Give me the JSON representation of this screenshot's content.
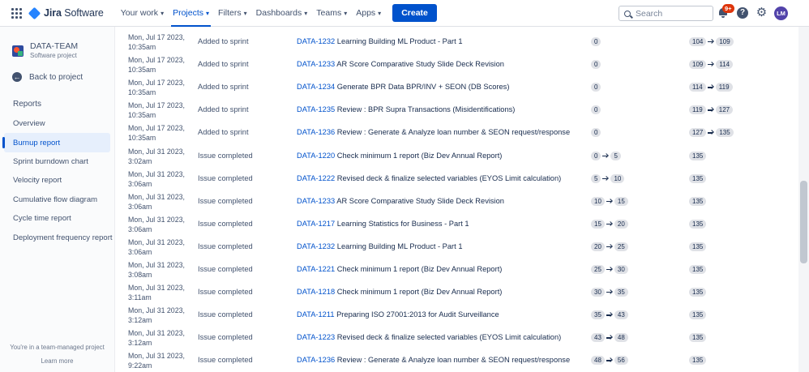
{
  "topnav": {
    "logo_bold": "Jira",
    "logo_rest": " Software",
    "items": [
      {
        "label": "Your work"
      },
      {
        "label": "Projects"
      },
      {
        "label": "Filters"
      },
      {
        "label": "Dashboards"
      },
      {
        "label": "Teams"
      },
      {
        "label": "Apps"
      }
    ],
    "active_item": "Projects",
    "create_label": "Create",
    "search_placeholder": "Search",
    "notifications_badge": "9+",
    "help_glyph": "?",
    "avatar_initials": "LM",
    "colors": {
      "primary": "#0052cc",
      "badge": "#de350b",
      "avatar": "#5243aa"
    }
  },
  "sidebar": {
    "project_name": "DATA-TEAM",
    "project_type": "Software project",
    "back_label": "Back to project",
    "section_heading": "Reports",
    "items": [
      {
        "label": "Overview",
        "active": false
      },
      {
        "label": "Burnup report",
        "active": true
      },
      {
        "label": "Sprint burndown chart",
        "active": false
      },
      {
        "label": "Velocity report",
        "active": false
      },
      {
        "label": "Cumulative flow diagram",
        "active": false
      },
      {
        "label": "Cycle time report",
        "active": false
      },
      {
        "label": "Deployment frequency report",
        "active": false
      }
    ],
    "footer_text": "You're in a team-managed project",
    "footer_link": "Learn more"
  },
  "rows": [
    {
      "date1": "Mon, Jul 17 2023,",
      "date2": "10:35am",
      "event": "Added to sprint",
      "key": "DATA-1232",
      "summary": "Learning Building ML Product - Part 1",
      "points": [
        "0"
      ],
      "total": [
        "104",
        "109"
      ]
    },
    {
      "date1": "Mon, Jul 17 2023,",
      "date2": "10:35am",
      "event": "Added to sprint",
      "key": "DATA-1233",
      "summary": "AR Score Comparative Study Slide Deck Revision",
      "points": [
        "0"
      ],
      "total": [
        "109",
        "114"
      ]
    },
    {
      "date1": "Mon, Jul 17 2023,",
      "date2": "10:35am",
      "event": "Added to sprint",
      "key": "DATA-1234",
      "summary": "Generate BPR Data BPR/INV + SEON (DB Scores)",
      "points": [
        "0"
      ],
      "total": [
        "114",
        "119"
      ]
    },
    {
      "date1": "Mon, Jul 17 2023,",
      "date2": "10:35am",
      "event": "Added to sprint",
      "key": "DATA-1235",
      "summary": "Review : BPR Supra Transactions (Misidentifications)",
      "points": [
        "0"
      ],
      "total": [
        "119",
        "127"
      ]
    },
    {
      "date1": "Mon, Jul 17 2023,",
      "date2": "10:35am",
      "event": "Added to sprint",
      "key": "DATA-1236",
      "summary": "Review : Generate & Analyze loan number & SEON request/response",
      "points": [
        "0"
      ],
      "total": [
        "127",
        "135"
      ]
    },
    {
      "date1": "Mon, Jul 31 2023,",
      "date2": "3:02am",
      "event": "Issue completed",
      "key": "DATA-1220",
      "summary": "Check minimum 1 report (Biz Dev Annual Report)",
      "points": [
        "0",
        "5"
      ],
      "total": [
        "135"
      ]
    },
    {
      "date1": "Mon, Jul 31 2023,",
      "date2": "3:06am",
      "event": "Issue completed",
      "key": "DATA-1222",
      "summary": "Revised deck & finalize selected variables (EYOS Limit calculation)",
      "points": [
        "5",
        "10"
      ],
      "total": [
        "135"
      ]
    },
    {
      "date1": "Mon, Jul 31 2023,",
      "date2": "3:06am",
      "event": "Issue completed",
      "key": "DATA-1233",
      "summary": "AR Score Comparative Study Slide Deck Revision",
      "points": [
        "10",
        "15"
      ],
      "total": [
        "135"
      ]
    },
    {
      "date1": "Mon, Jul 31 2023,",
      "date2": "3:06am",
      "event": "Issue completed",
      "key": "DATA-1217",
      "summary": "Learning Statistics for Business - Part 1",
      "points": [
        "15",
        "20"
      ],
      "total": [
        "135"
      ]
    },
    {
      "date1": "Mon, Jul 31 2023,",
      "date2": "3:06am",
      "event": "Issue completed",
      "key": "DATA-1232",
      "summary": "Learning Building ML Product - Part 1",
      "points": [
        "20",
        "25"
      ],
      "total": [
        "135"
      ]
    },
    {
      "date1": "Mon, Jul 31 2023,",
      "date2": "3:08am",
      "event": "Issue completed",
      "key": "DATA-1221",
      "summary": "Check minimum 1 report (Biz Dev Annual Report)",
      "points": [
        "25",
        "30"
      ],
      "total": [
        "135"
      ]
    },
    {
      "date1": "Mon, Jul 31 2023,",
      "date2": "3:11am",
      "event": "Issue completed",
      "key": "DATA-1218",
      "summary": "Check minimum 1 report (Biz Dev Annual Report)",
      "points": [
        "30",
        "35"
      ],
      "total": [
        "135"
      ]
    },
    {
      "date1": "Mon, Jul 31 2023,",
      "date2": "3:12am",
      "event": "Issue completed",
      "key": "DATA-1211",
      "summary": "Preparing ISO 27001:2013 for Audit Surveillance",
      "points": [
        "35",
        "43"
      ],
      "total": [
        "135"
      ]
    },
    {
      "date1": "Mon, Jul 31 2023,",
      "date2": "3:12am",
      "event": "Issue completed",
      "key": "DATA-1223",
      "summary": "Revised deck & finalize selected variables (EYOS Limit calculation)",
      "points": [
        "43",
        "48"
      ],
      "total": [
        "135"
      ]
    },
    {
      "date1": "Mon, Jul 31 2023,",
      "date2": "9:22am",
      "event": "Issue completed",
      "key": "DATA-1236",
      "summary": "Review : Generate & Analyze loan number & SEON request/response",
      "points": [
        "48",
        "56"
      ],
      "total": [
        "135"
      ]
    }
  ]
}
